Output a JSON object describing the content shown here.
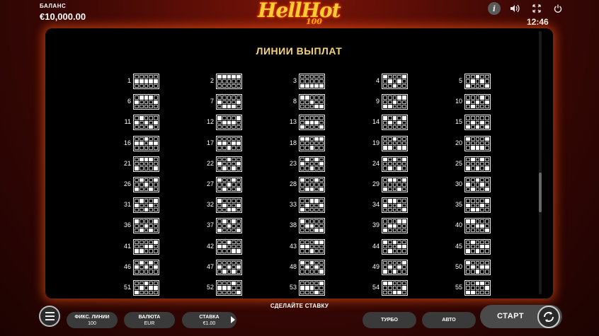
{
  "header": {
    "balance_label": "БАЛАНС",
    "balance_value": "€10,000.00",
    "logo_main": "HellHot",
    "logo_sub": "100",
    "clock": "12:46",
    "info_glyph": "i"
  },
  "panel": {
    "title": "ЛИНИИ ВЫПЛАТ",
    "lines": [
      {
        "n": "1",
        "rows": [
          1,
          1,
          1,
          1,
          1
        ]
      },
      {
        "n": "2",
        "rows": [
          0,
          0,
          0,
          0,
          0
        ]
      },
      {
        "n": "3",
        "rows": [
          2,
          2,
          2,
          2,
          2
        ]
      },
      {
        "n": "4",
        "rows": [
          0,
          1,
          2,
          1,
          0
        ]
      },
      {
        "n": "5",
        "rows": [
          2,
          1,
          0,
          1,
          2
        ]
      },
      {
        "n": "6",
        "rows": [
          1,
          0,
          0,
          0,
          1
        ]
      },
      {
        "n": "7",
        "rows": [
          1,
          2,
          2,
          2,
          1
        ]
      },
      {
        "n": "8",
        "rows": [
          0,
          0,
          1,
          2,
          2
        ]
      },
      {
        "n": "9",
        "rows": [
          2,
          2,
          1,
          0,
          0
        ]
      },
      {
        "n": "10",
        "rows": [
          1,
          2,
          1,
          0,
          1
        ]
      },
      {
        "n": "11",
        "rows": [
          1,
          0,
          1,
          2,
          1
        ]
      },
      {
        "n": "12",
        "rows": [
          0,
          1,
          1,
          1,
          0
        ]
      },
      {
        "n": "13",
        "rows": [
          2,
          1,
          1,
          1,
          2
        ]
      },
      {
        "n": "14",
        "rows": [
          0,
          1,
          0,
          1,
          0
        ]
      },
      {
        "n": "15",
        "rows": [
          2,
          1,
          2,
          1,
          2
        ]
      },
      {
        "n": "16",
        "rows": [
          1,
          1,
          0,
          1,
          1
        ]
      },
      {
        "n": "17",
        "rows": [
          1,
          1,
          2,
          1,
          1
        ]
      },
      {
        "n": "18",
        "rows": [
          0,
          0,
          2,
          0,
          0
        ]
      },
      {
        "n": "19",
        "rows": [
          2,
          2,
          0,
          2,
          2
        ]
      },
      {
        "n": "20",
        "rows": [
          0,
          2,
          2,
          2,
          0
        ]
      },
      {
        "n": "21",
        "rows": [
          2,
          0,
          0,
          0,
          2
        ]
      },
      {
        "n": "22",
        "rows": [
          1,
          2,
          0,
          2,
          1
        ]
      },
      {
        "n": "23",
        "rows": [
          1,
          0,
          2,
          0,
          1
        ]
      },
      {
        "n": "24",
        "rows": [
          0,
          2,
          0,
          2,
          0
        ]
      },
      {
        "n": "25",
        "rows": [
          2,
          0,
          2,
          0,
          2
        ]
      },
      {
        "n": "26",
        "rows": [
          2,
          0,
          1,
          2,
          0
        ]
      },
      {
        "n": "27",
        "rows": [
          0,
          2,
          1,
          0,
          2
        ]
      },
      {
        "n": "28",
        "rows": [
          0,
          2,
          2,
          0,
          2
        ]
      },
      {
        "n": "29",
        "rows": [
          2,
          0,
          0,
          2,
          0
        ]
      },
      {
        "n": "30",
        "rows": [
          1,
          2,
          0,
          1,
          2
        ]
      },
      {
        "n": "31",
        "rows": [
          1,
          0,
          2,
          1,
          0
        ]
      },
      {
        "n": "32",
        "rows": [
          0,
          1,
          2,
          2,
          1
        ]
      },
      {
        "n": "33",
        "rows": [
          2,
          1,
          0,
          0,
          1
        ]
      },
      {
        "n": "34",
        "rows": [
          1,
          0,
          0,
          1,
          2
        ]
      },
      {
        "n": "35",
        "rows": [
          1,
          2,
          2,
          1,
          0
        ]
      },
      {
        "n": "36",
        "rows": [
          0,
          2,
          1,
          2,
          0
        ]
      },
      {
        "n": "37",
        "rows": [
          2,
          0,
          1,
          0,
          2
        ]
      },
      {
        "n": "38",
        "rows": [
          0,
          1,
          1,
          2,
          2
        ]
      },
      {
        "n": "39",
        "rows": [
          2,
          1,
          1,
          0,
          0
        ]
      },
      {
        "n": "40",
        "rows": [
          0,
          0,
          1,
          1,
          2
        ]
      },
      {
        "n": "41",
        "rows": [
          2,
          2,
          1,
          1,
          0
        ]
      },
      {
        "n": "42",
        "rows": [
          1,
          1,
          0,
          2,
          2
        ]
      },
      {
        "n": "43",
        "rows": [
          1,
          1,
          2,
          0,
          0
        ]
      },
      {
        "n": "44",
        "rows": [
          0,
          2,
          0,
          1,
          1
        ]
      },
      {
        "n": "45",
        "rows": [
          2,
          0,
          2,
          1,
          1
        ]
      },
      {
        "n": "46",
        "rows": [
          1,
          0,
          1,
          0,
          1
        ]
      },
      {
        "n": "47",
        "rows": [
          1,
          2,
          1,
          2,
          1
        ]
      },
      {
        "n": "48",
        "rows": [
          0,
          1,
          0,
          1,
          2
        ]
      },
      {
        "n": "49",
        "rows": [
          2,
          1,
          2,
          1,
          0
        ]
      },
      {
        "n": "50",
        "rows": [
          0,
          1,
          2,
          1,
          1
        ]
      },
      {
        "n": "51",
        "rows": [
          2,
          1,
          0,
          1,
          1
        ]
      },
      {
        "n": "52",
        "rows": [
          1,
          1,
          1,
          0,
          2
        ]
      },
      {
        "n": "53",
        "rows": [
          1,
          1,
          1,
          2,
          0
        ]
      },
      {
        "n": "54",
        "rows": [
          0,
          0,
          2,
          2,
          1
        ]
      },
      {
        "n": "55",
        "rows": [
          2,
          2,
          0,
          0,
          1
        ]
      }
    ]
  },
  "controls": {
    "prompt": "СДЕЛАЙТЕ СТАВКУ",
    "lines_label": "ФИКС. ЛИНИИ",
    "lines_value": "100",
    "currency_label": "ВАЛЮТА",
    "currency_value": "EUR",
    "bet_label": "СТАВКА",
    "bet_value": "€1.00",
    "turbo_label": "ТУРБО",
    "auto_label": "АВТО",
    "start_label": "СТАРТ"
  },
  "colors": {
    "title": "#f4d47a",
    "glow": "#ff5a14",
    "panel_bg": "#000000"
  },
  "icons": [
    "info-icon",
    "sound-icon",
    "fullscreen-icon",
    "power-icon",
    "menu-icon",
    "spin-icon"
  ]
}
